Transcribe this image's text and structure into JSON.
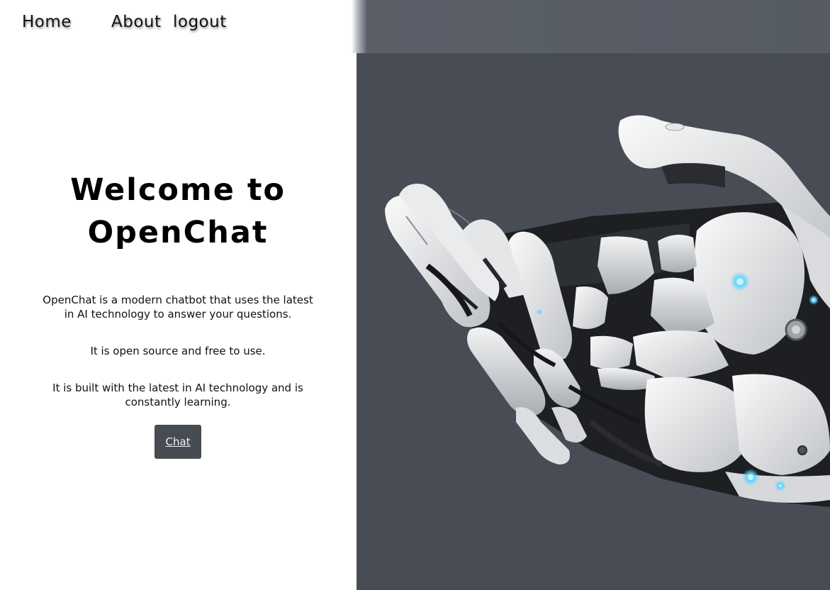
{
  "nav": {
    "home": "Home",
    "about": "About",
    "logout": "logout"
  },
  "hero": {
    "title_line1": "Welcome to",
    "title_line2": "OpenChat",
    "paragraph1": "OpenChat is a modern chatbot that uses the latest in AI technology to answer your questions.",
    "paragraph2": "It is open source and free to use.",
    "paragraph3": "It is built with the latest in AI technology and is constantly learning.",
    "chat_button": "Chat"
  },
  "image": {
    "subject": "robotic-hand-illustration"
  },
  "colors": {
    "nav_bar_right": "#565b64",
    "image_panel": "#484c54",
    "chat_button": "#474b52"
  }
}
